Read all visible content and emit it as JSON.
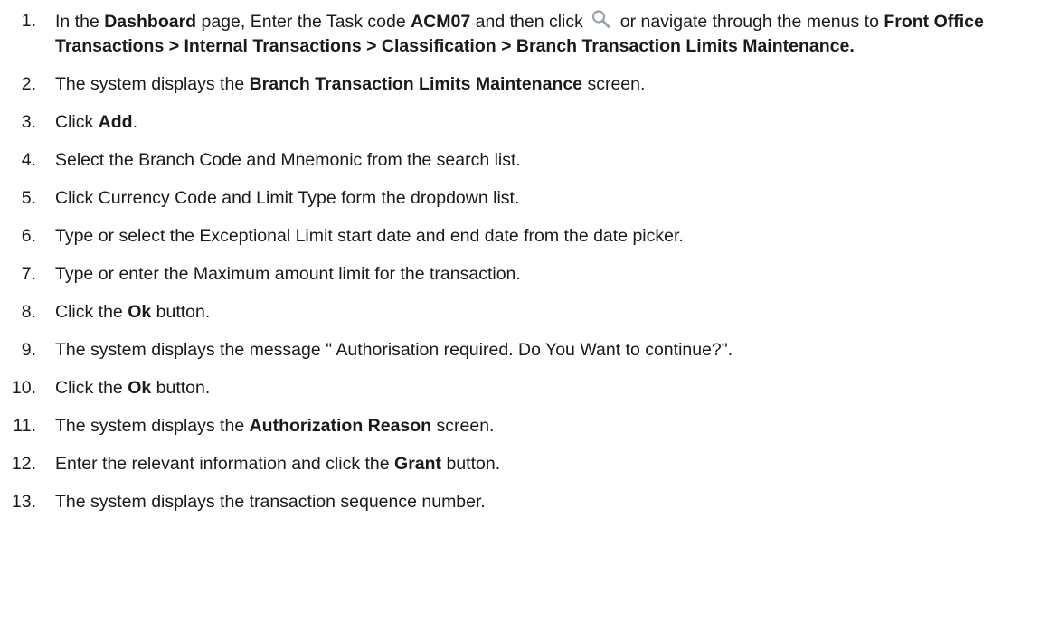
{
  "steps": [
    {
      "num": "1.",
      "parts": [
        {
          "t": "In the "
        },
        {
          "t": "Dashboard",
          "b": true
        },
        {
          "t": " page, Enter the Task code "
        },
        {
          "t": "ACM07",
          "b": true
        },
        {
          "t": " and then click "
        },
        {
          "icon": "search-icon"
        },
        {
          "t": " or navigate through the menus to "
        },
        {
          "t": "Front Office Transactions > Internal Transactions > Classification > Branch Transaction Limits Maintenance.",
          "b": true
        }
      ]
    },
    {
      "num": "2.",
      "parts": [
        {
          "t": "The system displays the "
        },
        {
          "t": "Branch Transaction Limits Maintenance",
          "b": true
        },
        {
          "t": " screen."
        }
      ]
    },
    {
      "num": "3.",
      "parts": [
        {
          "t": "Click "
        },
        {
          "t": "Add",
          "b": true
        },
        {
          "t": "."
        }
      ]
    },
    {
      "num": "4.",
      "parts": [
        {
          "t": "Select the Branch Code and Mnemonic from the search list."
        }
      ]
    },
    {
      "num": "5.",
      "parts": [
        {
          "t": "Click Currency Code and Limit Type form the dropdown list."
        }
      ]
    },
    {
      "num": "6.",
      "parts": [
        {
          "t": "Type or select the Exceptional Limit start date and end date from the date picker."
        }
      ]
    },
    {
      "num": "7.",
      "parts": [
        {
          "t": "Type or enter the Maximum amount limit for the transaction."
        }
      ]
    },
    {
      "num": "8.",
      "parts": [
        {
          "t": "Click the "
        },
        {
          "t": "Ok",
          "b": true
        },
        {
          "t": " button."
        }
      ]
    },
    {
      "num": "9.",
      "parts": [
        {
          "t": "The system displays the message \" Authorisation required. Do You Want to continue?\"."
        }
      ]
    },
    {
      "num": "10.",
      "parts": [
        {
          "t": "Click the "
        },
        {
          "t": "Ok",
          "b": true
        },
        {
          "t": " button."
        }
      ]
    },
    {
      "num": "11.",
      "parts": [
        {
          "t": "The system displays the "
        },
        {
          "t": "Authorization Reason",
          "b": true
        },
        {
          "t": " screen."
        }
      ]
    },
    {
      "num": "12.",
      "parts": [
        {
          "t": "Enter the relevant information and click the "
        },
        {
          "t": "Grant",
          "b": true
        },
        {
          "t": " button."
        }
      ]
    },
    {
      "num": "13.",
      "parts": [
        {
          "t": "The system displays the transaction sequence number."
        }
      ]
    }
  ],
  "colors": {
    "text": "#1a1a1a",
    "icon": "#9aa3ab"
  }
}
